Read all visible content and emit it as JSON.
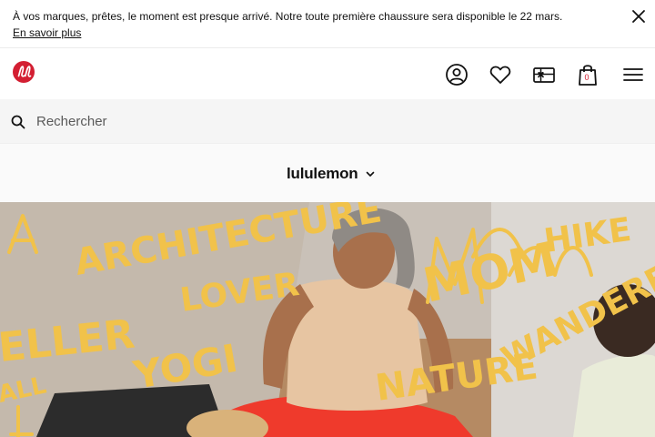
{
  "promo": {
    "message": "À vos marques, prêtes, le moment est presque arrivé. Notre toute première chaussure sera disponible le 22 mars.",
    "link_label": "En savoir plus",
    "close_icon": "close-icon"
  },
  "header": {
    "logo": "lululemon-logo",
    "icons": [
      "account-icon",
      "wishlist-heart-icon",
      "gift-card-icon",
      "shopping-bag-icon",
      "menu-icon"
    ],
    "bag_count": "0"
  },
  "search": {
    "placeholder": "Rechercher",
    "icon": "search-icon"
  },
  "brand": {
    "selected": "lululemon",
    "icon": "chevron-down-icon"
  },
  "hero": {
    "words": [
      "ARCHITECTURE",
      "LOVER",
      "ELLER",
      "YOGI",
      "MOM",
      "HIKE",
      "NATURE",
      "WANDERE",
      "ALL"
    ],
    "colors": {
      "accent": "#f1c24a",
      "brand": "#d31f32"
    }
  }
}
